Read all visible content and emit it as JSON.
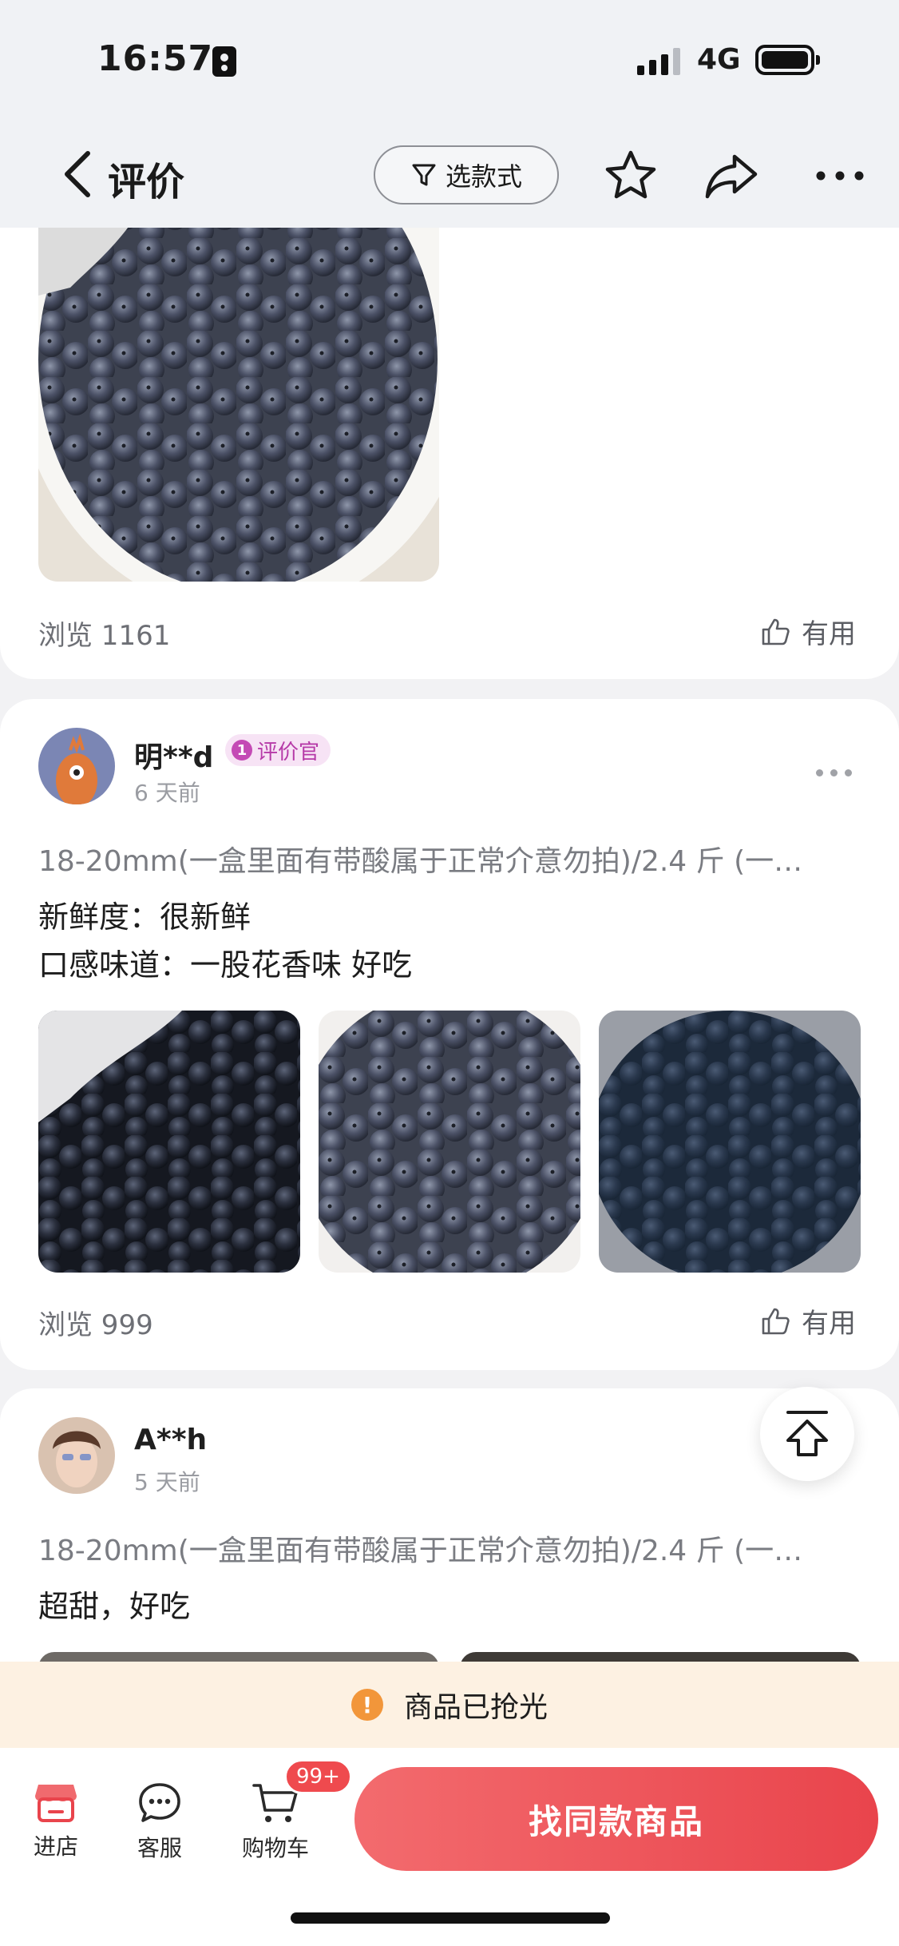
{
  "status_bar": {
    "time": "16:57",
    "network": "4G"
  },
  "nav": {
    "title": "评价",
    "filter_label": "选款式"
  },
  "reviews": [
    {
      "views": "浏览 1161",
      "useful": "有用"
    },
    {
      "user": "明**d",
      "badge": "评价官",
      "badge_num": "1",
      "time": "6 天前",
      "sku": "18-20mm(一盒里面有带酸属于正常介意勿拍)/2.4 斤 (一…",
      "lines": [
        "新鲜度：很新鲜",
        "口感味道：一股花香味 好吃"
      ],
      "views": "浏览 999",
      "useful": "有用"
    },
    {
      "user": "A**h",
      "time": "5 天前",
      "sku": "18-20mm(一盒里面有带酸属于正常介意勿拍)/2.4 斤 (一…",
      "lines": [
        "超甜，好吃"
      ]
    }
  ],
  "sold_out": {
    "text": "商品已抢光",
    "icon": "!"
  },
  "bottom_bar": {
    "store": "进店",
    "service": "客服",
    "cart": "购物车",
    "cart_badge": "99+",
    "action": "找同款商品"
  },
  "colors": {
    "accent": "#e9444c",
    "badge": "#c44ab5",
    "warning": "#f2963a"
  }
}
